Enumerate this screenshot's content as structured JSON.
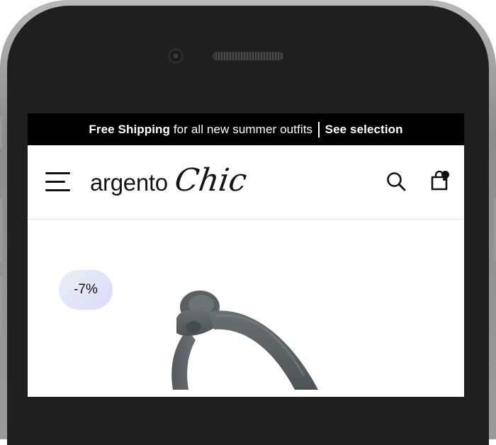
{
  "promo_bar": {
    "highlight": "Free Shipping",
    "text": "for all new summer outfits",
    "link": "See selection"
  },
  "header": {
    "logo_main": "argento",
    "logo_script": "Chic",
    "icons": {
      "menu": "hamburger-menu-icon",
      "search": "search-icon",
      "cart": "shopping-bag-icon"
    },
    "cart_has_items": true
  },
  "product": {
    "discount_badge": "-7%",
    "image": "gray-product-image"
  },
  "colors": {
    "promo_background": "#000000",
    "badge_gradient_start": "#e7f1f5",
    "badge_gradient_end": "#ddd9fb",
    "product_gray": "#555a5d"
  }
}
